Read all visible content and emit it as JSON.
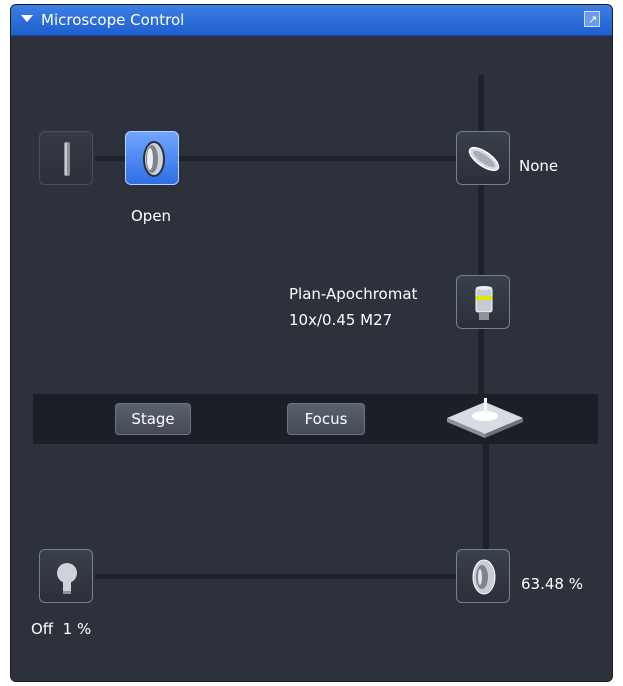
{
  "panel": {
    "title": "Microscope Control"
  },
  "reflector": {
    "label": "Open"
  },
  "beam_splitter": {
    "label": "None"
  },
  "objective": {
    "name": "Plan-Apochromat",
    "spec": "10x/0.45 M27"
  },
  "stage_bar": {
    "stage_label": "Stage",
    "focus_label": "Focus"
  },
  "lamp": {
    "label": "Off  1 %"
  },
  "transmitted": {
    "label": "63.48 %"
  },
  "icons": [
    "chevron-down-icon",
    "undock-icon",
    "slider-icon",
    "lens-icon",
    "mirror-icon",
    "objective-icon",
    "stage-icon",
    "lamp-icon",
    "filter-wheel-icon"
  ]
}
